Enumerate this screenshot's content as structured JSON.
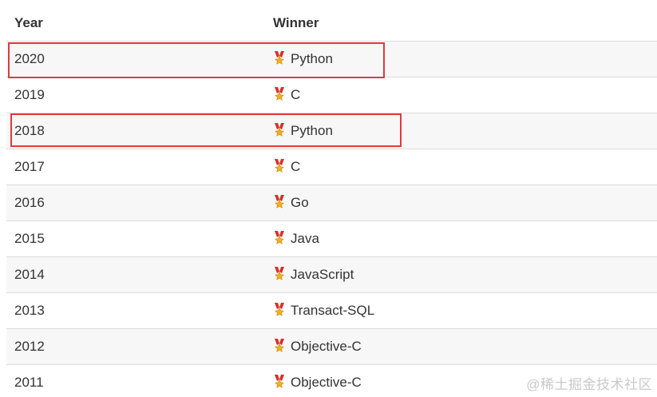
{
  "table": {
    "headers": {
      "year": "Year",
      "winner": "Winner"
    },
    "rows": [
      {
        "year": "2020",
        "winner": "Python"
      },
      {
        "year": "2019",
        "winner": "C"
      },
      {
        "year": "2018",
        "winner": "Python"
      },
      {
        "year": "2017",
        "winner": "C"
      },
      {
        "year": "2016",
        "winner": "Go"
      },
      {
        "year": "2015",
        "winner": "Java"
      },
      {
        "year": "2014",
        "winner": "JavaScript"
      },
      {
        "year": "2013",
        "winner": "Transact-SQL"
      },
      {
        "year": "2012",
        "winner": "Objective-C"
      },
      {
        "year": "2011",
        "winner": "Objective-C"
      }
    ],
    "winner_icon": "medal-icon",
    "highlighted_years": [
      "2020",
      "2018"
    ]
  },
  "colors": {
    "highlight_border": "#e0393e",
    "stripe_row": "#f7f7f7",
    "medal_ribbon": "#d9302c",
    "medal_gold": "#f2b01e"
  },
  "watermark": {
    "text": "@稀土掘金技术社区"
  }
}
